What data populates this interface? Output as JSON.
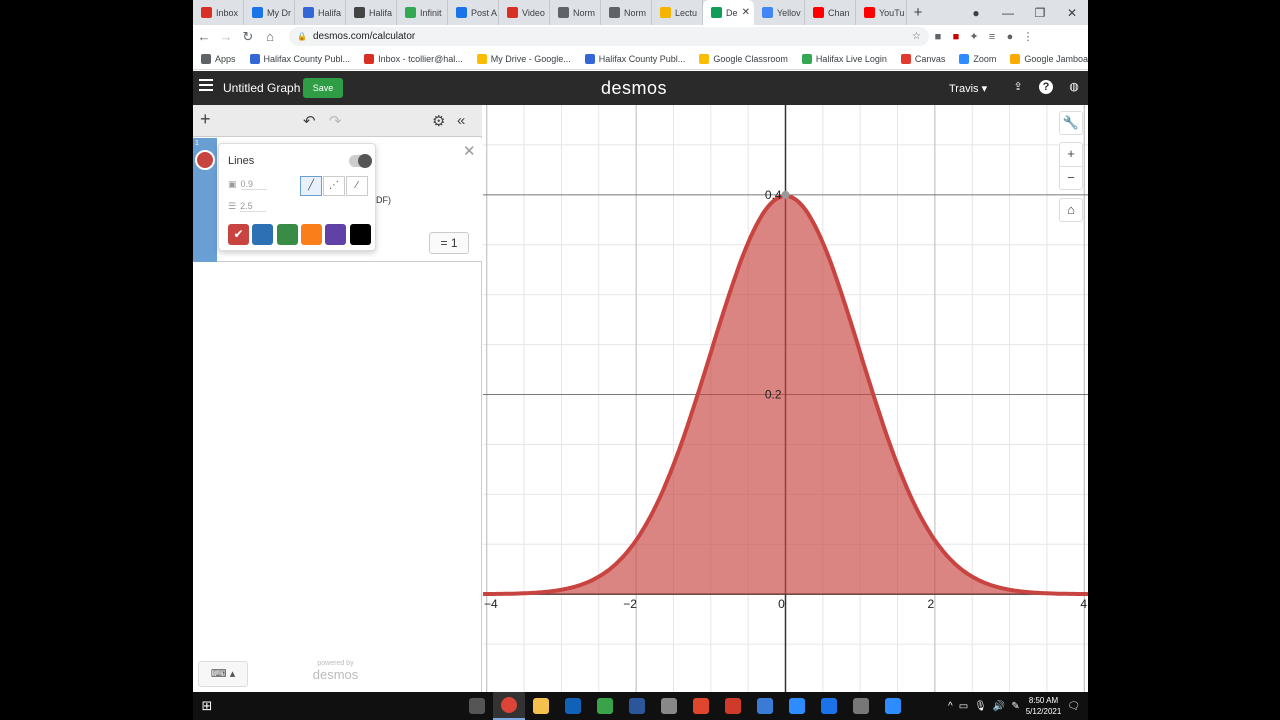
{
  "browser": {
    "tabs": [
      {
        "label": "Inbox",
        "color": "#d93025"
      },
      {
        "label": "My Dr",
        "color": "#1a73e8"
      },
      {
        "label": "Halifa",
        "color": "#3367d6"
      },
      {
        "label": "Halifa",
        "color": "#444444"
      },
      {
        "label": "Infinit",
        "color": "#34a853"
      },
      {
        "label": "Post A",
        "color": "#1a73e8"
      },
      {
        "label": "Video",
        "color": "#d93025"
      },
      {
        "label": "Norm",
        "color": "#5f6368"
      },
      {
        "label": "Norm",
        "color": "#5f6368"
      },
      {
        "label": "Lectu",
        "color": "#f4b400"
      },
      {
        "label": "De",
        "color": "#0f9d58",
        "active": true
      },
      {
        "label": "Yellov",
        "color": "#4285f4"
      },
      {
        "label": "Chan",
        "color": "#ff0000"
      },
      {
        "label": "YouTu",
        "color": "#ff0000"
      }
    ],
    "url": "desmos.com/calculator",
    "bookmarks": [
      {
        "label": "Apps",
        "color": "#5f6368"
      },
      {
        "label": "Halifax County Publ...",
        "color": "#3367d6"
      },
      {
        "label": "Inbox - tcollier@hal...",
        "color": "#d93025"
      },
      {
        "label": "My Drive - Google...",
        "color": "#fbbc04"
      },
      {
        "label": "Halifax County Publ...",
        "color": "#3367d6"
      },
      {
        "label": "Google Classroom",
        "color": "#fbbc04"
      },
      {
        "label": "Halifax Live Login",
        "color": "#34a853"
      },
      {
        "label": "Canvas",
        "color": "#e23a2e"
      },
      {
        "label": "Zoom",
        "color": "#2d8cff"
      },
      {
        "label": "Google Jamboard",
        "color": "#f9ab00"
      }
    ]
  },
  "desmos": {
    "graph_title": "Untitled Graph",
    "save_label": "Save",
    "logo": "desmos",
    "user": "Travis",
    "expression": {
      "number": "1",
      "fragment": "DF)",
      "equals_value": "= 1",
      "style_popup": {
        "lines_label": "Lines",
        "opacity_value": "0.9",
        "width_value": "2.5"
      },
      "colors": [
        "#c74440",
        "#2d70b3",
        "#388c46",
        "#fa7e19",
        "#6042a6",
        "#000000"
      ]
    },
    "powered_by": "powered by",
    "powered_logo": "desmos",
    "accent": "#c74440"
  },
  "chart_data": {
    "type": "area",
    "function": "normal pdf, mean 0, sd 1",
    "x": [
      -4,
      -3.5,
      -3,
      -2.5,
      -2,
      -1.5,
      -1,
      -0.5,
      0,
      0.5,
      1,
      1.5,
      2,
      2.5,
      3,
      3.5,
      4
    ],
    "y": [
      0.0001,
      0.0009,
      0.0044,
      0.0175,
      0.054,
      0.1295,
      0.242,
      0.3521,
      0.3989,
      0.3521,
      0.242,
      0.1295,
      0.054,
      0.0175,
      0.0044,
      0.0009,
      0.0001
    ],
    "xlim": [
      -4.05,
      4.05
    ],
    "ylim": [
      -0.098,
      0.29
    ],
    "x_ticks": [
      -4,
      -2,
      0,
      2,
      4
    ],
    "y_ticks": [
      0.2,
      0.4
    ],
    "grid": true,
    "color": "#c74440",
    "marked_point": [
      0,
      0.4
    ]
  },
  "taskbar": {
    "apps": [
      {
        "name": "task-view",
        "color": "#555555"
      },
      {
        "name": "chrome",
        "color": "#db4437",
        "active": true
      },
      {
        "name": "explorer",
        "color": "#f2c14e"
      },
      {
        "name": "outlook",
        "color": "#0f62b8"
      },
      {
        "name": "app-2",
        "color": "#3aa34a"
      },
      {
        "name": "word",
        "color": "#2b579a"
      },
      {
        "name": "printer",
        "color": "#888888"
      },
      {
        "name": "red-app",
        "color": "#e0452d"
      },
      {
        "name": "red-app-2",
        "color": "#d03a2a"
      },
      {
        "name": "photos",
        "color": "#3a7bd5"
      },
      {
        "name": "zoom",
        "color": "#2d8cff"
      },
      {
        "name": "w-app",
        "color": "#1a73e8"
      },
      {
        "name": "tools",
        "color": "#777777"
      },
      {
        "name": "zoom-2",
        "color": "#2d8cff"
      }
    ],
    "time": "8:50 AM",
    "date": "5/12/2021"
  }
}
